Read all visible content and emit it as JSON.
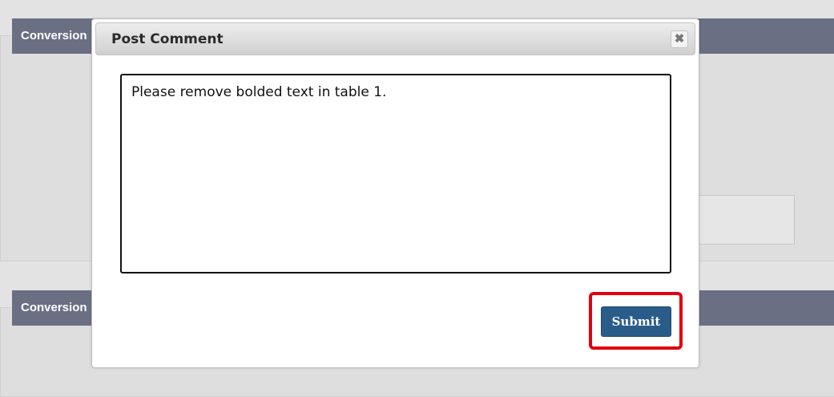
{
  "background": {
    "panels": [
      {
        "header": "Conversion"
      },
      {
        "header": "Conversion"
      }
    ]
  },
  "dialog": {
    "title": "Post Comment",
    "close_icon": "close-icon",
    "comment_text": "Please remove bolded text in table 1.",
    "submit_label": "Submit",
    "highlight_color": "#e0000f",
    "submit_color": "#2a5c89"
  }
}
